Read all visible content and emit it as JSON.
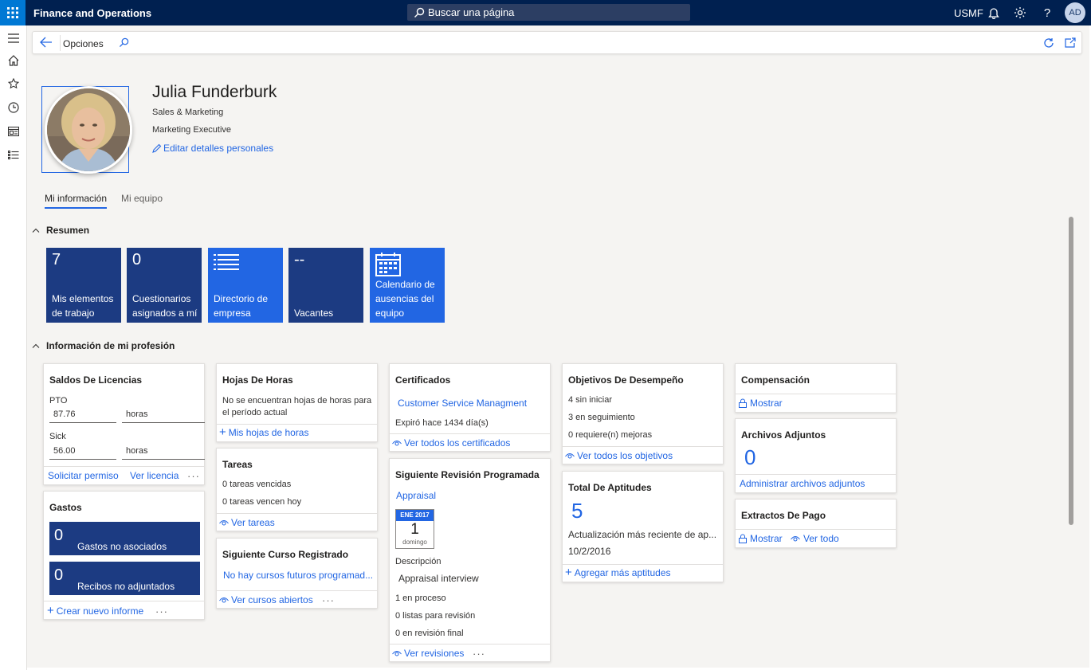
{
  "app": {
    "title": "Finance and Operations",
    "search_placeholder": "Buscar una página",
    "company": "USMF",
    "user_initials": "AD"
  },
  "actionbar": {
    "title": "Opciones"
  },
  "profile": {
    "name": "Julia Funderburk",
    "department": "Sales & Marketing",
    "job_title": "Marketing Executive",
    "edit_link": "Editar detalles personales"
  },
  "tabs": [
    {
      "label": "Mi información"
    },
    {
      "label": "Mi equipo"
    }
  ],
  "sections": {
    "summary": "Resumen",
    "profession": "Información de mi profesión"
  },
  "tiles": [
    {
      "value": "7",
      "label": "Mis elementos de trabajo",
      "color": "#1c3b82"
    },
    {
      "value": "0",
      "label": "Cuestionarios asignados a mí",
      "color": "#1c3b82"
    },
    {
      "value": "",
      "label": "Directorio de empresa",
      "color": "#2266e3",
      "icon": "list-icon"
    },
    {
      "value": "--",
      "label": "Vacantes",
      "color": "#1c3b82"
    },
    {
      "value": "",
      "label": "Calendario de ausencias del equipo",
      "color": "#2266e3",
      "icon": "calendar-icon"
    }
  ],
  "leave": {
    "title": "Saldos De Licencias",
    "rows": [
      {
        "type": "PTO",
        "value": "87.76",
        "unit": "horas"
      },
      {
        "type": "Sick",
        "value": "56.00",
        "unit": "horas"
      }
    ],
    "request_link": "Solicitar permiso",
    "view_link": "Ver licencia",
    "more": "···"
  },
  "expenses": {
    "title": "Gastos",
    "tiles": [
      {
        "value": "0",
        "label": "Gastos no asociados"
      },
      {
        "value": "0",
        "label": "Recibos no adjuntados"
      }
    ],
    "create_link": "Crear nuevo informe",
    "more": "···"
  },
  "timesheets": {
    "title": "Hojas De Horas",
    "message": "No se encuentran hojas de horas para el período actual",
    "link": "Mis hojas de horas"
  },
  "tasks": {
    "title": "Tareas",
    "overdue": "0 tareas vencidas",
    "due_today": "0 tareas vencen hoy",
    "link": "Ver tareas"
  },
  "next_course": {
    "title": "Siguiente Curso Registrado",
    "message": "No hay cursos futuros programad...",
    "link": "Ver cursos abiertos",
    "more": "···"
  },
  "certificates": {
    "title": "Certificados",
    "item": "Customer Service Managment",
    "expired": "Expiró hace 1434 día(s)",
    "link": "Ver todos los certificados"
  },
  "next_review": {
    "title": "Siguiente Revisión Programada",
    "link_top": "Appraisal",
    "cal_month": "ENE 2017",
    "cal_day": "1",
    "cal_weekday": "domingo",
    "desc_label": "Descripción",
    "desc_value": "Appraisal interview",
    "in_process": "1 en proceso",
    "ready": "0 listas para revisión",
    "final": "0 en revisión final",
    "link": "Ver revisiones",
    "more": "···"
  },
  "goals": {
    "title": "Objetivos De Desempeño",
    "not_started": "4 sin iniciar",
    "tracking": "3 en seguimiento",
    "improve": "0 requiere(n) mejoras",
    "link": "Ver todos los objetivos"
  },
  "skills": {
    "title": "Total De Aptitudes",
    "count": "5",
    "update_label": "Actualización más reciente de ap...",
    "update_date": "10/2/2016",
    "link": "Agregar más aptitudes"
  },
  "compensation": {
    "title": "Compensación",
    "link": "Mostrar"
  },
  "attachments": {
    "title": "Archivos Adjuntos",
    "count": "0",
    "link": "Administrar archivos adjuntos"
  },
  "payslips": {
    "title": "Extractos De Pago",
    "show": "Mostrar",
    "view_all": "Ver todo"
  }
}
